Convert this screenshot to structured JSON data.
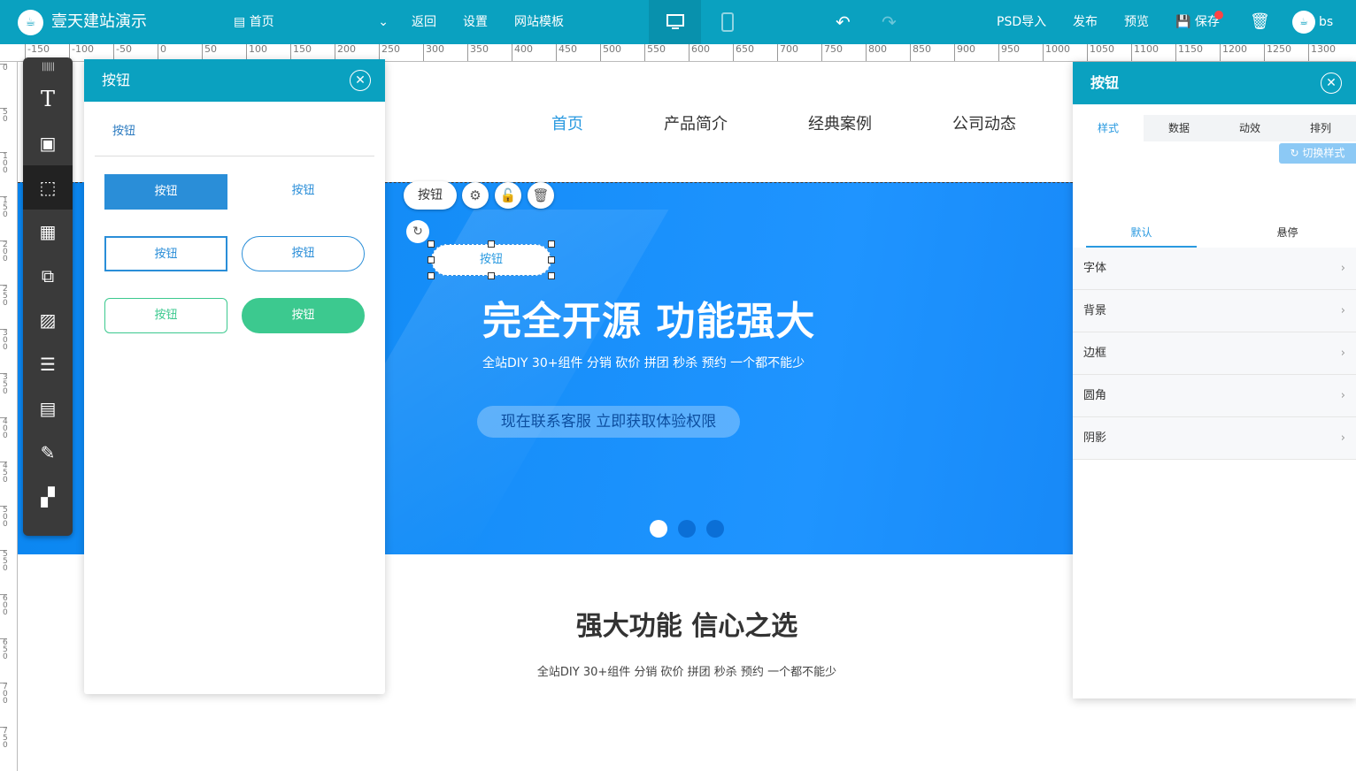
{
  "topbar": {
    "logo_glyph": "☕",
    "brand": "壹天建站演示",
    "page_select": "首页",
    "nav": [
      "返回",
      "设置",
      "网站模板"
    ],
    "actions": {
      "psd": "PSD导入",
      "publish": "发布",
      "preview": "预览",
      "save": "保存"
    },
    "user": "bs"
  },
  "ruler": {
    "h_labels": [
      "-150",
      "-100",
      "-50",
      "0",
      "50",
      "100",
      "150",
      "200",
      "250",
      "300",
      "350",
      "400",
      "450",
      "500",
      "550",
      "600",
      "650",
      "700",
      "750",
      "800",
      "850",
      "900",
      "950",
      "1000",
      "1050",
      "1100",
      "1150",
      "1200",
      "1250",
      "1300"
    ],
    "v_labels": [
      "0",
      "50",
      "100",
      "150",
      "200",
      "250",
      "300",
      "350",
      "400",
      "450",
      "500",
      "550",
      "600",
      "650",
      "700",
      "750"
    ]
  },
  "site": {
    "nav": [
      "首页",
      "产品简介",
      "经典案例",
      "公司动态"
    ],
    "banner_title": "完全开源  功能强大",
    "banner_sub": "全站DIY 30+组件 分销 砍价 拼团 秒杀 预约 一个都不能少",
    "banner_cta": "现在联系客服  立即获取体验权限",
    "section_title": "强大功能 信心之选",
    "section_desc": "全站DIY 30+组件 分销 砍价 拼团 秒杀 预约 一个都不能少"
  },
  "editor": {
    "selected_label": "按钮",
    "selected_button_text": "按钮"
  },
  "left_panel": {
    "title": "按钮",
    "category": "按钮",
    "samples": [
      "按钮",
      "按钮",
      "按钮",
      "按钮",
      "按钮",
      "按钮"
    ]
  },
  "right_panel": {
    "title": "按钮",
    "tabs": [
      "样式",
      "数据",
      "动效",
      "排列"
    ],
    "switch_style": "切换样式",
    "subtabs": [
      "默认",
      "悬停"
    ],
    "props": [
      "字体",
      "背景",
      "边框",
      "圆角",
      "阴影"
    ]
  },
  "colors": {
    "accent": "#0aa1c0",
    "link": "#2a9ae0",
    "green": "#3cc98f"
  }
}
